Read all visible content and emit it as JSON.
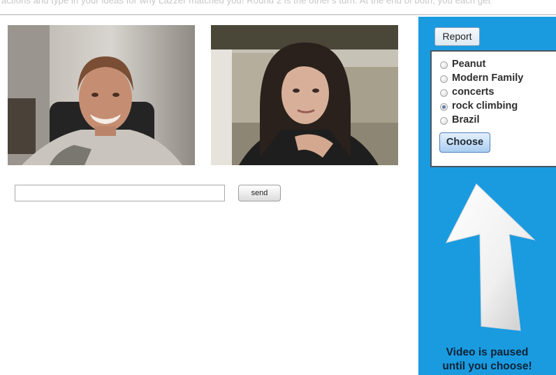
{
  "header": {
    "instructions_text": "actions and type in your ideas for why Lazzer matched you! Round 2 is the other's turn. At the end of both, you each get"
  },
  "videos": {
    "left": {
      "label": "user-webcam"
    },
    "right": {
      "label": "partner-webcam"
    }
  },
  "chat": {
    "input_value": "",
    "input_placeholder": "",
    "send_label": "send"
  },
  "side_panel": {
    "background_color": "#1a9be0",
    "report_label": "Report",
    "options": [
      {
        "label": "Peanut",
        "checked": false
      },
      {
        "label": "Modern Family",
        "checked": false
      },
      {
        "label": "concerts",
        "checked": false
      },
      {
        "label": "rock climbing",
        "checked": true
      },
      {
        "label": "Brazil",
        "checked": false
      }
    ],
    "choose_label": "Choose",
    "arrow_icon": "up-arrow-icon",
    "paused_line1": "Video is paused",
    "paused_line2": "until you choose!"
  }
}
